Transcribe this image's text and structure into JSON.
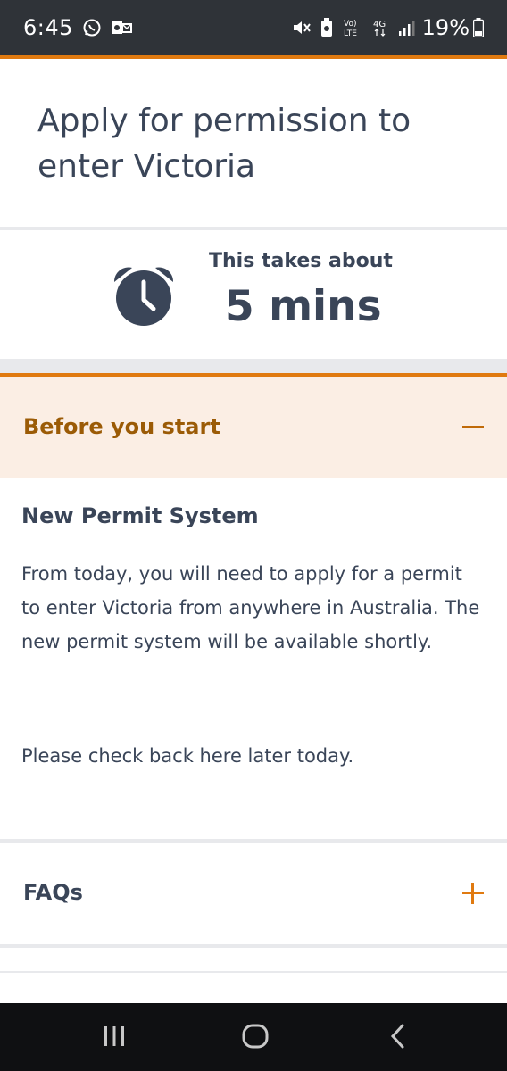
{
  "status_bar": {
    "time": "6:45",
    "battery": "19%",
    "icons": [
      "whatsapp-icon",
      "outlook-icon",
      "mute-icon",
      "battery-saver-icon",
      "volte-icon",
      "4g-icon",
      "signal-icon",
      "battery-icon"
    ]
  },
  "header": {
    "title": "Apply for permission to enter Victoria"
  },
  "estimate": {
    "label": "This takes about",
    "value": "5 mins",
    "icon": "alarm-clock-icon"
  },
  "before_start": {
    "heading": "Before you start",
    "toggle_icon": "minus-icon",
    "subheading": "New Permit System",
    "paragraph1": "From today, you will need to apply for a permit to enter Victoria from anywhere in Australia. The new permit system will be available shortly.",
    "paragraph2": "Please check back here later today."
  },
  "faqs": {
    "heading": "FAQs",
    "toggle_icon": "plus-icon"
  },
  "colors": {
    "accent": "#e07a10",
    "heading_orange": "#9b5b06",
    "text": "#3a4558",
    "accordion_bg": "#fbeee4",
    "statusbar": "#2f3338",
    "navbar": "#0f1012"
  }
}
